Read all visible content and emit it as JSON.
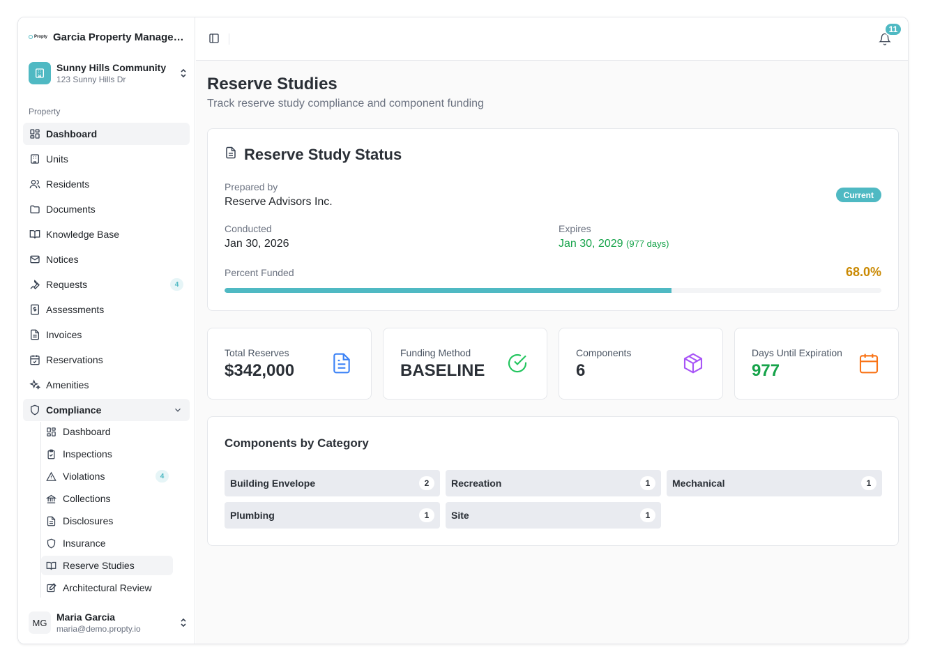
{
  "brand": {
    "logo_text": "Propty",
    "name": "Garcia Property Managem..."
  },
  "community": {
    "name": "Sunny Hills Community",
    "address": "123 Sunny Hills Dr"
  },
  "sidebar": {
    "section_label": "Property",
    "items": [
      {
        "label": "Dashboard",
        "icon": "dashboard-icon"
      },
      {
        "label": "Units",
        "icon": "building-icon"
      },
      {
        "label": "Residents",
        "icon": "users-icon"
      },
      {
        "label": "Documents",
        "icon": "folder-icon"
      },
      {
        "label": "Knowledge Base",
        "icon": "book-icon"
      },
      {
        "label": "Notices",
        "icon": "mail-icon"
      },
      {
        "label": "Requests",
        "icon": "wrench-icon",
        "badge": "4"
      },
      {
        "label": "Assessments",
        "icon": "dollar-receipt-icon"
      },
      {
        "label": "Invoices",
        "icon": "file-icon"
      },
      {
        "label": "Reservations",
        "icon": "calendar-check-icon"
      },
      {
        "label": "Amenities",
        "icon": "sparkles-icon"
      },
      {
        "label": "Compliance",
        "icon": "shield-icon"
      }
    ],
    "compliance_sub": [
      {
        "label": "Dashboard",
        "icon": "dashboard-icon"
      },
      {
        "label": "Inspections",
        "icon": "clipboard-check-icon"
      },
      {
        "label": "Violations",
        "icon": "warning-icon",
        "badge": "4"
      },
      {
        "label": "Collections",
        "icon": "bank-icon"
      },
      {
        "label": "Disclosures",
        "icon": "file-text-icon"
      },
      {
        "label": "Insurance",
        "icon": "shield-icon"
      },
      {
        "label": "Reserve Studies",
        "icon": "book-icon"
      },
      {
        "label": "Architectural Review",
        "icon": "edit-icon"
      }
    ]
  },
  "user": {
    "initials": "MG",
    "name": "Maria Garcia",
    "email": "maria@demo.propty.io"
  },
  "topbar": {
    "notification_count": "11"
  },
  "page": {
    "title": "Reserve Studies",
    "subtitle": "Track reserve study compliance and component funding"
  },
  "status": {
    "title": "Reserve Study Status",
    "prepared_by_label": "Prepared by",
    "prepared_by": "Reserve Advisors Inc.",
    "status_badge": "Current",
    "conducted_label": "Conducted",
    "conducted": "Jan 30, 2026",
    "expires_label": "Expires",
    "expires": "Jan 30, 2029",
    "expires_days": "(977 days)",
    "percent_label": "Percent Funded",
    "percent_text": "68.0%",
    "percent_value": 0.68,
    "colors": {
      "accent": "#4fb9c3",
      "funded": "#ca8a04",
      "ok": "#16a34a"
    }
  },
  "stats": [
    {
      "label": "Total Reserves",
      "value": "$342,000",
      "icon": "document-icon",
      "color": "#3b82f6"
    },
    {
      "label": "Funding Method",
      "value": "BASELINE",
      "icon": "check-circle-icon",
      "color": "#22c55e"
    },
    {
      "label": "Components",
      "value": "6",
      "icon": "box-icon",
      "color": "#a855f7"
    },
    {
      "label": "Days Until Expiration",
      "value": "977",
      "icon": "calendar-icon",
      "color": "#f97316"
    }
  ],
  "categories": {
    "title": "Components by Category",
    "items": [
      {
        "name": "Building Envelope",
        "count": "2"
      },
      {
        "name": "Recreation",
        "count": "1"
      },
      {
        "name": "Mechanical",
        "count": "1"
      },
      {
        "name": "Plumbing",
        "count": "1"
      },
      {
        "name": "Site",
        "count": "1"
      }
    ]
  }
}
